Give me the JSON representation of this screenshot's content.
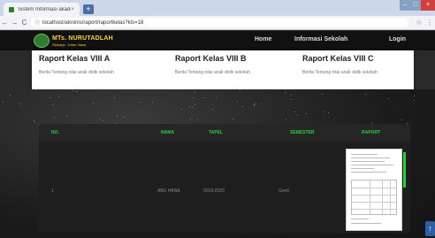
{
  "browser": {
    "tab_title": "Sistem Informasi akademik",
    "tab_close": "×",
    "new_tab": "+",
    "window_controls": [
      "–",
      "□",
      "×"
    ],
    "nav_back": "←",
    "nav_forward": "→",
    "nav_reload": "C",
    "url_info": "ⓘ",
    "url": "localhost/akronis/raport/raportkelas?kls=18",
    "star": "☆",
    "menu": "⋮"
  },
  "site": {
    "logo_title": "MTs. NURUTADLAH",
    "logo_subtitle": "Sidoarjo - Krian Jawa",
    "nav": {
      "home": "Home",
      "info": "Informasi Sekolah",
      "login": "Login"
    }
  },
  "cards": [
    {
      "title": "Raport Kelas VIII A",
      "desc": "Berita Tentang nilai anak didik sekolah"
    },
    {
      "title": "Raport Kelas VIII B",
      "desc": "Berita Tentang nilai anak didik sekolah"
    },
    {
      "title": "Raport Kelas VIII C",
      "desc": "Berita Tentang nilai anak didik sekolah"
    }
  ],
  "table": {
    "headers": [
      "NO.",
      "NAMA",
      "TAPEL",
      "SEMESTER",
      "RAPORT"
    ],
    "rows": [
      {
        "no": "1",
        "nama": "ABU HANA",
        "tapel": "2019-2020",
        "semester": "Genil"
      }
    ]
  },
  "scroll_top": "↑",
  "colors": {
    "accent_green": "#2ecc40",
    "logo_yellow": "#f5d742",
    "navbar": "#111111",
    "scroll_button": "#2b5fa8"
  }
}
